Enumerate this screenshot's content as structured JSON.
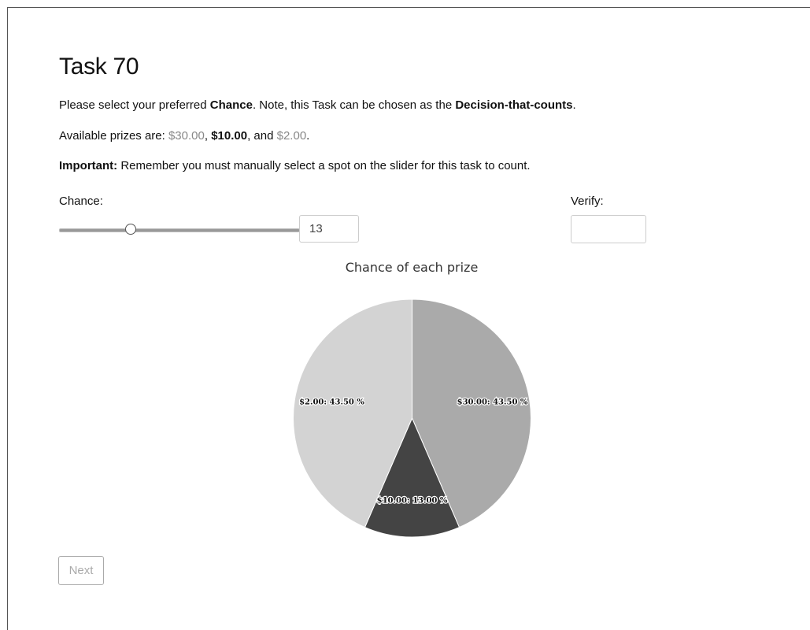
{
  "task": {
    "title": "Task 70",
    "instruction": {
      "pre": "Please select your preferred ",
      "bold1": "Chance",
      "mid": ". Note, this Task can be chosen as the ",
      "bold2": "Decision-that-counts",
      "post": "."
    },
    "prizes": {
      "pre": "Available prizes are: ",
      "p1": "$30.00",
      "sep1": ", ",
      "p2": "$10.00",
      "sep2": ", and ",
      "p3": "$2.00",
      "post": "."
    },
    "important": {
      "bold": "Important:",
      "text": " Remember you must manually select a spot on the slider for this task to count."
    }
  },
  "chance": {
    "label": "Chance:",
    "value": "13",
    "slider_fraction": 0.13
  },
  "verify": {
    "label": "Verify:",
    "value": ""
  },
  "chart_data": {
    "type": "pie",
    "title": "Chance of each prize",
    "slices": [
      {
        "label": "$30.00: 43.50 %",
        "value": 43.5,
        "color": "#aaaaaa"
      },
      {
        "label": "$10.00: 13.00 %",
        "value": 13.0,
        "color": "#444444"
      },
      {
        "label": "$2.00: 43.50 %",
        "value": 43.5,
        "color": "#d3d3d3"
      }
    ]
  },
  "next_label": "Next"
}
